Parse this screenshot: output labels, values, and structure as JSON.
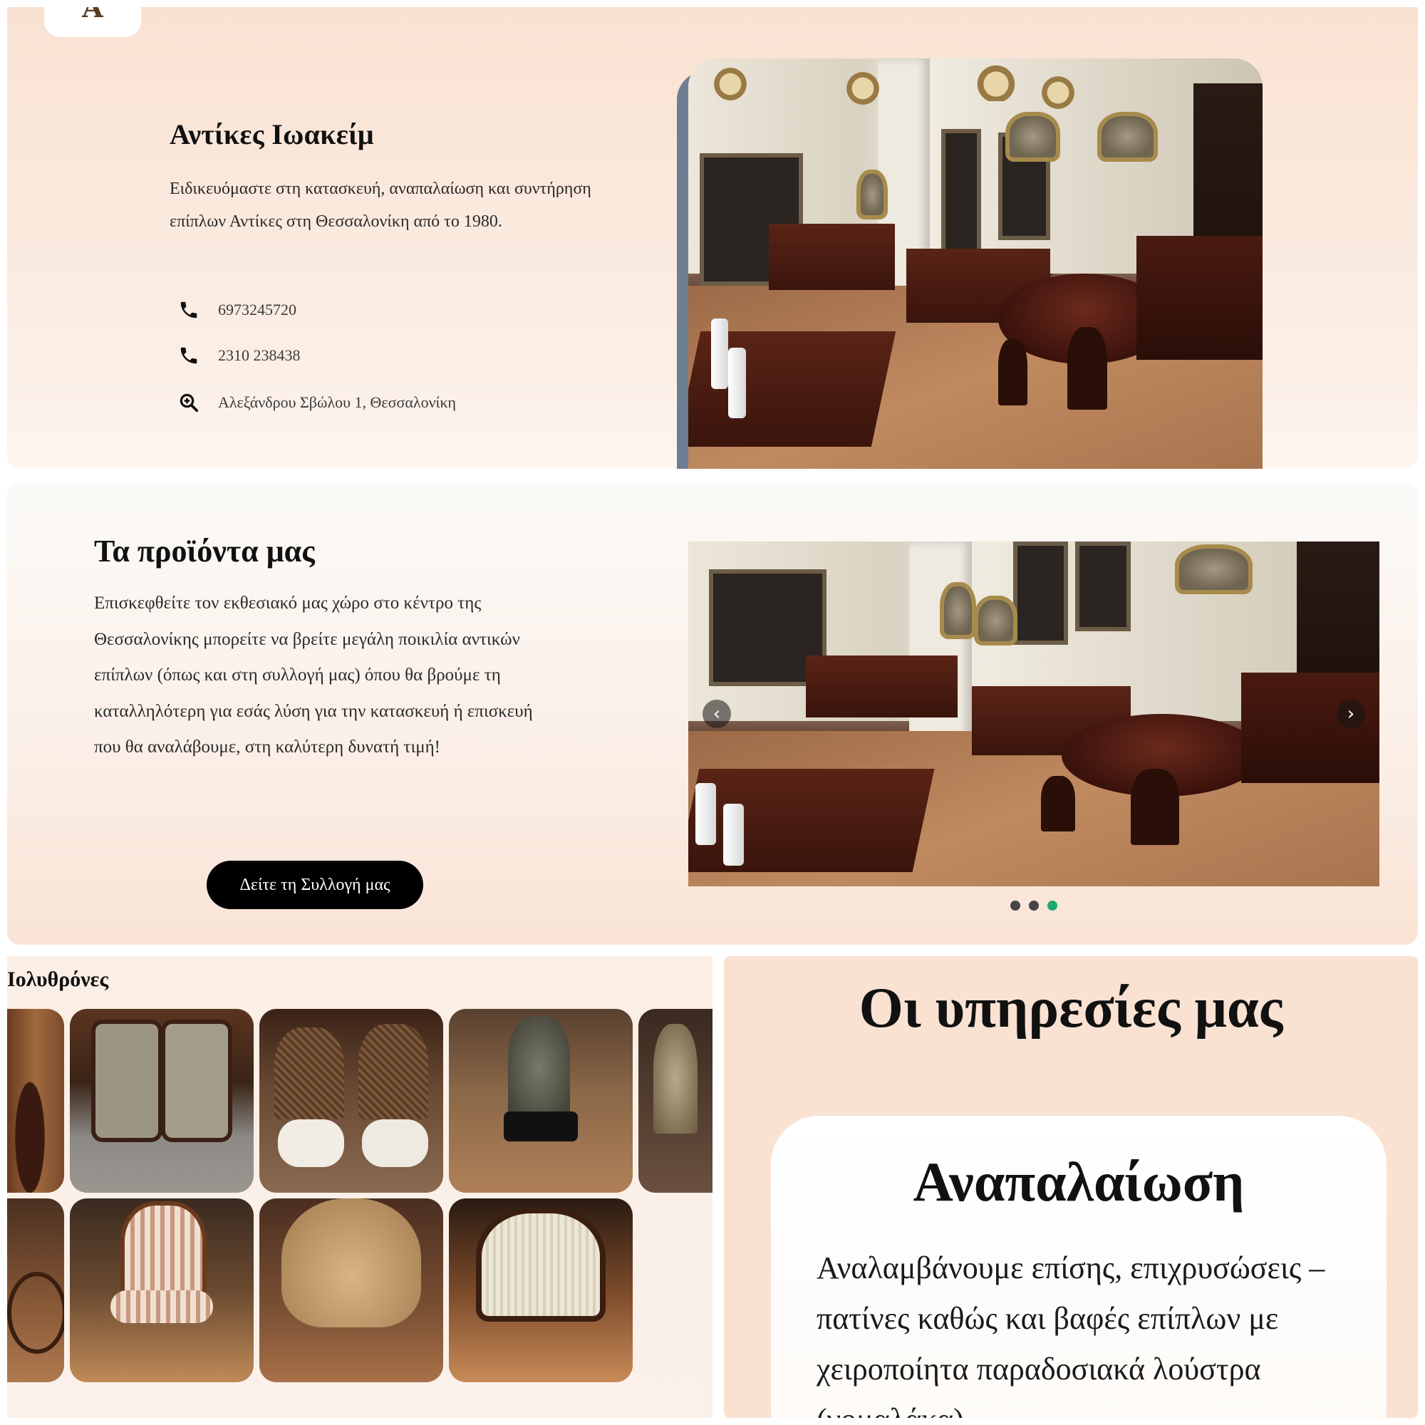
{
  "hero": {
    "logo_glyph": "A",
    "title": "Αντίκες Ιωακείμ",
    "description": "Ειδικευόμαστε στη κατασκευή, αναπαλαίωση και συντήρηση επίπλων Αντίκες στη Θεσσαλονίκη από το 1980.",
    "contacts": [
      {
        "icon": "phone-icon",
        "text": "6973245720"
      },
      {
        "icon": "phone-icon",
        "text": "2310 238438"
      },
      {
        "icon": "map-search-icon",
        "text": "Αλεξάνδρου Σβώλου 1, Θεσσαλονίκη"
      }
    ],
    "accent_color": "#6d7e93"
  },
  "products": {
    "title": "Τα προϊόντα μας",
    "description": "Επισκεφθείτε τον εκθεσιακό μας χώρο στο κέντρο της Θεσσαλονίκης μπορείτε να βρείτε μεγάλη ποικιλία αντικών επίπλων (όπως και στη συλλογή μας) όπου θα βρούμε τη καταλληλότερη για εσάς λύση για την κατασκευή ή επισκευή που θα αναλάβουμε, στη καλύτερη δυνατή τιμή!",
    "button_label": "Δείτε τη Συλλογή μας",
    "carousel": {
      "prev_icon": "chevron-left-icon",
      "next_icon": "chevron-right-icon",
      "slide_count": 3,
      "active_slide": 3,
      "active_dot_color": "#1fa870"
    }
  },
  "gallery": {
    "title": "Ιολυθρόνες",
    "thumbnails": [
      "chair-thumb-1",
      "chair-thumb-2",
      "chair-thumb-3",
      "chair-thumb-4",
      "chair-thumb-5",
      "chair-thumb-6",
      "chair-thumb-7",
      "chair-thumb-8",
      "chair-thumb-9"
    ]
  },
  "services": {
    "title": "Οι υπηρεσίες μας",
    "card": {
      "title": "Αναπαλαίωση",
      "description": "Αναλαμβάνουμε επίσης, επιχρυσώσεις – πατίνες καθώς και βαφές επίπλων με χειροποίητα παραδοσιακά λούστρα (γομαλάκα)"
    }
  },
  "colors": {
    "peach_background": "#f9e2d2",
    "button_background": "#000000"
  }
}
